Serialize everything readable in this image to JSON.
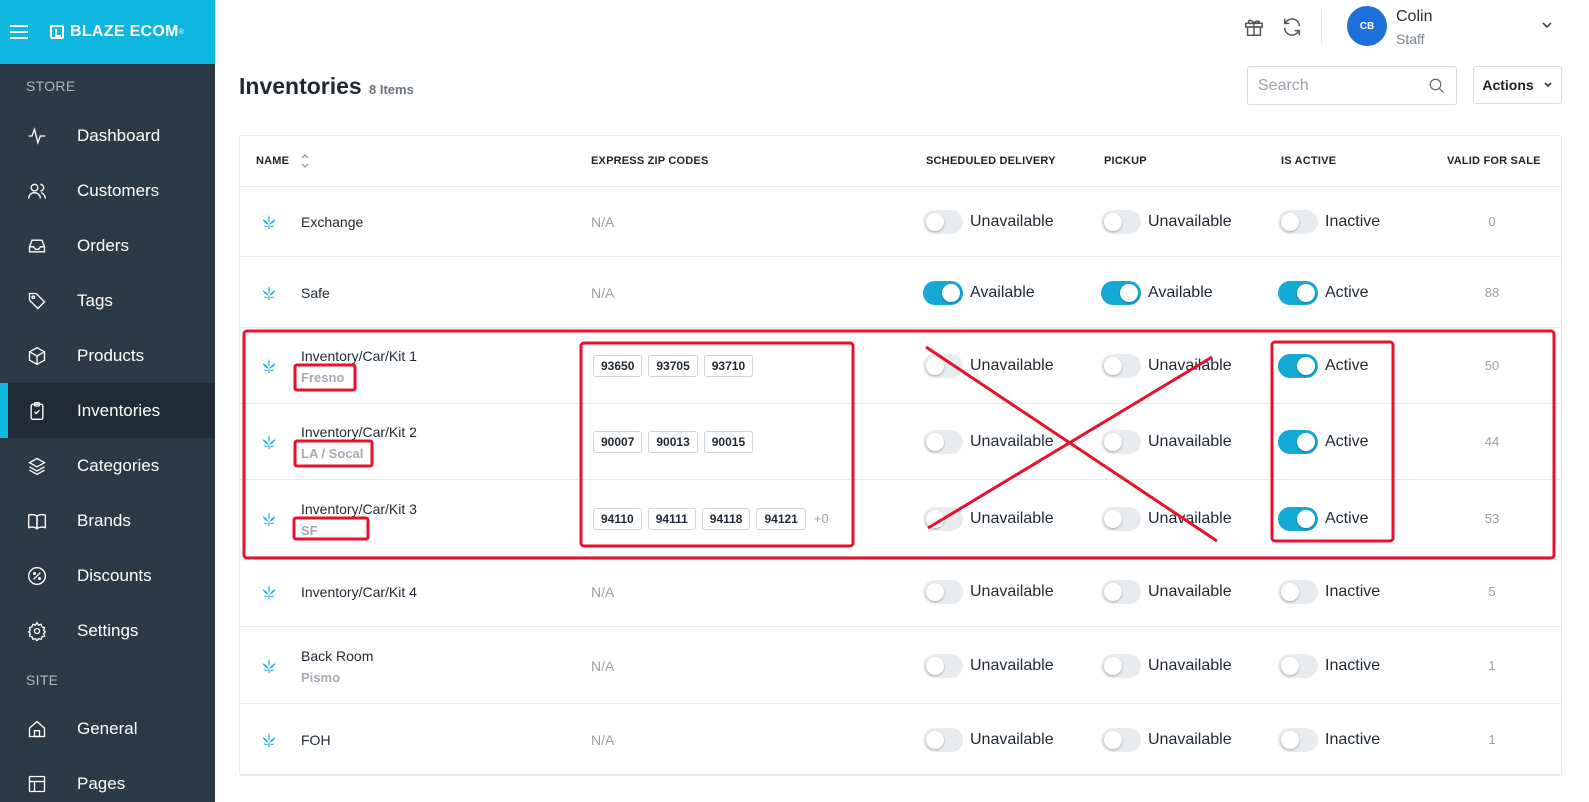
{
  "brand": {
    "name": "BLAZE ECOM",
    "mark": "®"
  },
  "sidebar": {
    "store_label": "STORE",
    "site_label": "SITE",
    "store_items": [
      {
        "label": "Dashboard",
        "icon": "activity-icon"
      },
      {
        "label": "Customers",
        "icon": "users-icon"
      },
      {
        "label": "Orders",
        "icon": "inbox-icon"
      },
      {
        "label": "Tags",
        "icon": "tag-icon"
      },
      {
        "label": "Products",
        "icon": "box-icon"
      },
      {
        "label": "Inventories",
        "icon": "clipboard-icon",
        "active": true
      },
      {
        "label": "Categories",
        "icon": "layers-icon"
      },
      {
        "label": "Brands",
        "icon": "book-icon"
      },
      {
        "label": "Discounts",
        "icon": "percent-icon"
      },
      {
        "label": "Settings",
        "icon": "gear-icon"
      }
    ],
    "site_items": [
      {
        "label": "General",
        "icon": "home-icon"
      },
      {
        "label": "Pages",
        "icon": "layout-icon"
      }
    ]
  },
  "header": {
    "user": {
      "initials": "CB",
      "name": "Colin",
      "role": "Staff"
    }
  },
  "page": {
    "title": "Inventories",
    "count": "8 Items",
    "search_placeholder": "Search",
    "actions_label": "Actions"
  },
  "table": {
    "columns": {
      "name": "NAME",
      "zip": "EXPRESS ZIP CODES",
      "delivery": "SCHEDULED DELIVERY",
      "pickup": "PICKUP",
      "active": "IS ACTIVE",
      "sale": "VALID FOR SALE"
    },
    "rows": [
      {
        "name": "Exchange",
        "sub": "",
        "zips": [],
        "zip_text": "N/A",
        "more": "",
        "delivery": "Unavailable",
        "delivery_on": false,
        "pickup": "Unavailable",
        "pickup_on": false,
        "active": "Inactive",
        "active_on": false,
        "sale": "0"
      },
      {
        "name": "Safe",
        "sub": "",
        "zips": [],
        "zip_text": "N/A",
        "more": "",
        "delivery": "Available",
        "delivery_on": true,
        "pickup": "Available",
        "pickup_on": true,
        "active": "Active",
        "active_on": true,
        "sale": "88"
      },
      {
        "name": "Inventory/Car/Kit 1",
        "sub": "Fresno",
        "zips": [
          "93650",
          "93705",
          "93710"
        ],
        "zip_text": "",
        "more": "",
        "delivery": "Unavailable",
        "delivery_on": false,
        "pickup": "Unavailable",
        "pickup_on": false,
        "active": "Active",
        "active_on": true,
        "sale": "50"
      },
      {
        "name": "Inventory/Car/Kit 2",
        "sub": "LA / Socal",
        "zips": [
          "90007",
          "90013",
          "90015"
        ],
        "zip_text": "",
        "more": "",
        "delivery": "Unavailable",
        "delivery_on": false,
        "pickup": "Unavailable",
        "pickup_on": false,
        "active": "Active",
        "active_on": true,
        "sale": "44"
      },
      {
        "name": "Inventory/Car/Kit 3",
        "sub": "SF",
        "zips": [
          "94110",
          "94111",
          "94118",
          "94121"
        ],
        "zip_text": "",
        "more": "+0",
        "delivery": "Unavailable",
        "delivery_on": false,
        "pickup": "Unavailable",
        "pickup_on": false,
        "active": "Active",
        "active_on": true,
        "sale": "53"
      },
      {
        "name": "Inventory/Car/Kit 4",
        "sub": "",
        "zips": [],
        "zip_text": "N/A",
        "more": "",
        "delivery": "Unavailable",
        "delivery_on": false,
        "pickup": "Unavailable",
        "pickup_on": false,
        "active": "Inactive",
        "active_on": false,
        "sale": "5"
      },
      {
        "name": "Back Room",
        "sub": "Pismo",
        "zips": [],
        "zip_text": "N/A",
        "more": "",
        "delivery": "Unavailable",
        "delivery_on": false,
        "pickup": "Unavailable",
        "pickup_on": false,
        "active": "Inactive",
        "active_on": false,
        "sale": "1"
      },
      {
        "name": "FOH",
        "sub": "",
        "zips": [],
        "zip_text": "N/A",
        "more": "",
        "delivery": "Unavailable",
        "delivery_on": false,
        "pickup": "Unavailable",
        "pickup_on": false,
        "active": "Inactive",
        "active_on": false,
        "sale": "1"
      }
    ]
  },
  "colors": {
    "brand": "#0fb6e0",
    "sidebar": "#2c3a47",
    "toggle_on": "#15a9d6",
    "annotation": "#e8112d"
  }
}
